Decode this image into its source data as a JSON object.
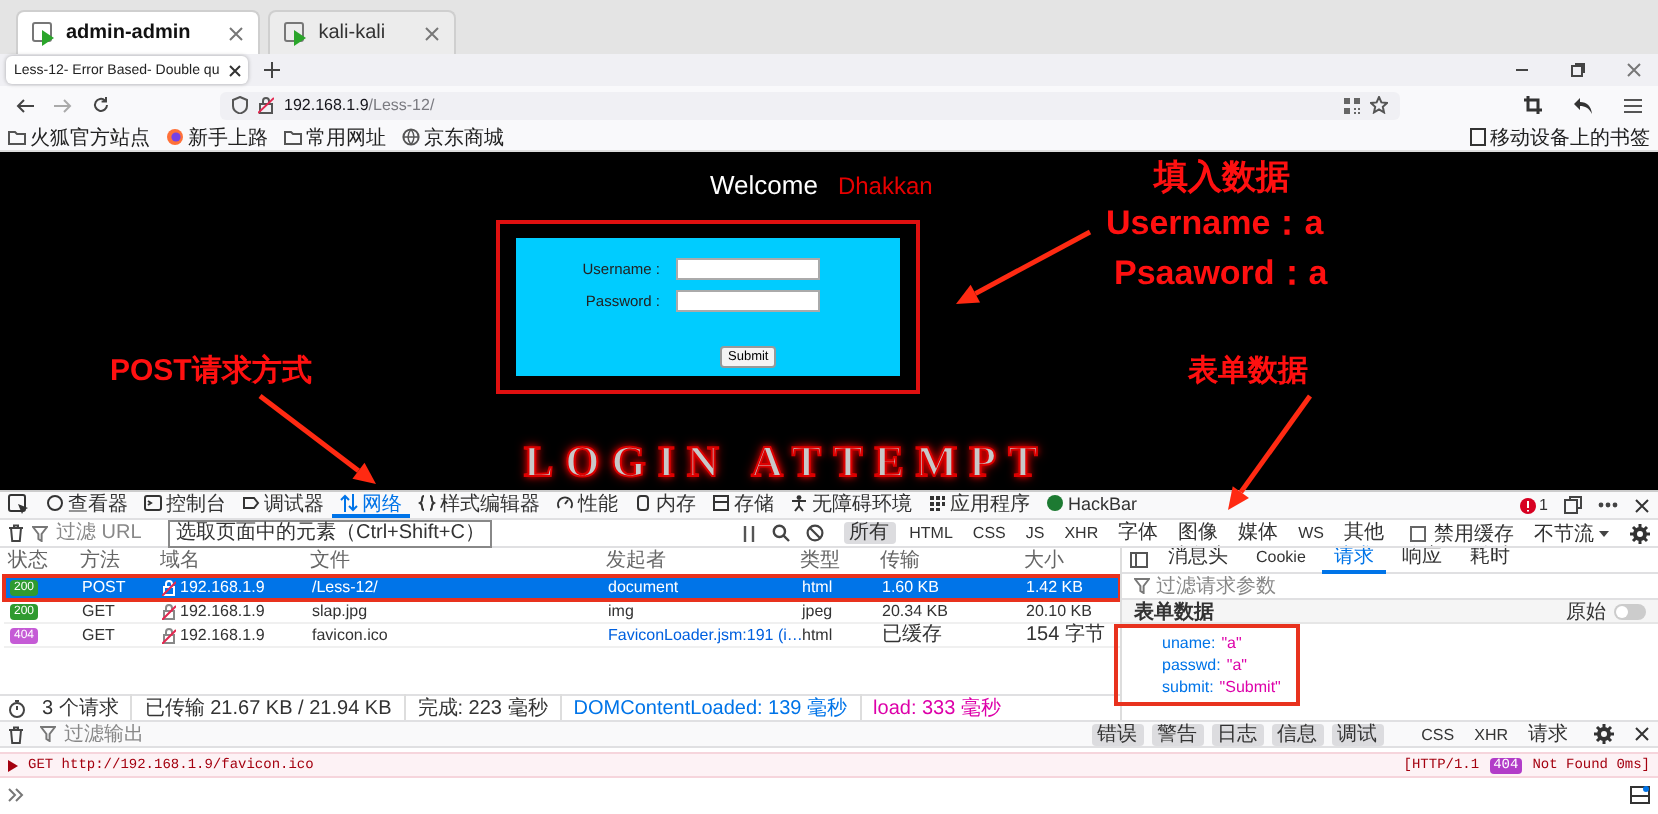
{
  "vm_tabs": [
    {
      "label": "admin-admin",
      "selected": true
    },
    {
      "label": "kali-kali",
      "selected": false
    }
  ],
  "browser_tab": {
    "title": "Less-12- Error Based- Double qu"
  },
  "address": {
    "host": "192.168.1.9",
    "path": "/Less-12/"
  },
  "bookmarks": [
    {
      "label": "火狐官方站点",
      "kind": "folder"
    },
    {
      "label": "新手上路",
      "kind": "firefox"
    },
    {
      "label": "常用网址",
      "kind": "folder"
    },
    {
      "label": "京东商城",
      "kind": "globe"
    }
  ],
  "mobile_bookmarks": {
    "label": "移动设备上的书签"
  },
  "page": {
    "welcome": "Welcome",
    "user": "Dhakkan",
    "form": {
      "highlighted": true,
      "fields": [
        {
          "label": "Username :"
        },
        {
          "label": "Password :"
        }
      ],
      "submit": "Submit"
    },
    "banner": "LOGIN ATTEMPT"
  },
  "annotations": [
    {
      "text": "填入数据"
    },
    {
      "text": "Username：a"
    },
    {
      "text": "Psaaword：a"
    },
    {
      "text": "POST请求方式"
    },
    {
      "text": "表单数据"
    }
  ],
  "devtools": {
    "tabs": [
      {
        "label": "查看器",
        "selected": false
      },
      {
        "label": "控制台",
        "selected": false
      },
      {
        "label": "调试器",
        "selected": false
      },
      {
        "label": "网络",
        "selected": true
      },
      {
        "label": "样式编辑器",
        "selected": false
      },
      {
        "label": "性能",
        "selected": false
      },
      {
        "label": "内存",
        "selected": false
      },
      {
        "label": "存储",
        "selected": false
      },
      {
        "label": "无障碍环境",
        "selected": false
      },
      {
        "label": "应用程序",
        "selected": false
      },
      {
        "label": "HackBar",
        "selected": false
      }
    ],
    "error_count": "1",
    "pick_tooltip": "选取页面中的元素（Ctrl+Shift+C）",
    "url_filter": {
      "placeholder": "过滤 URL"
    },
    "type_filters": [
      {
        "label": "所有",
        "selected": true
      },
      {
        "label": "HTML",
        "selected": false
      },
      {
        "label": "CSS",
        "selected": false
      },
      {
        "label": "JS",
        "selected": false
      },
      {
        "label": "XHR",
        "selected": false
      },
      {
        "label": "字体",
        "selected": false
      },
      {
        "label": "图像",
        "selected": false
      },
      {
        "label": "媒体",
        "selected": false
      },
      {
        "label": "WS",
        "selected": false
      },
      {
        "label": "其他",
        "selected": false
      }
    ],
    "disable_cache": {
      "label": "禁用缓存",
      "checked": false
    },
    "throttling": "不节流",
    "columns": [
      "状态",
      "方法",
      "域名",
      "文件",
      "发起者",
      "类型",
      "传输",
      "大小"
    ],
    "requests": [
      {
        "status": "200",
        "color": "#2f9a2f",
        "method": "POST",
        "domain": "192.168.1.9",
        "file": "/Less-12/",
        "initiator": "document",
        "initiator_link": false,
        "type": "html",
        "transferred": "1.60 KB",
        "size": "1.42 KB",
        "selected": true,
        "highlighted": true
      },
      {
        "status": "200",
        "color": "#2f9a2f",
        "method": "GET",
        "domain": "192.168.1.9",
        "file": "slap.jpg",
        "initiator": "img",
        "initiator_link": false,
        "type": "jpeg",
        "transferred": "20.34 KB",
        "size": "20.10 KB",
        "selected": false,
        "highlighted": false
      },
      {
        "status": "404",
        "color": "#c55bd6",
        "method": "GET",
        "domain": "192.168.1.9",
        "file": "favicon.ico",
        "initiator": "FaviconLoader.jsm:191 (i…",
        "initiator_link": true,
        "type": "html",
        "transferred": "已缓存",
        "size": "154 字节",
        "selected": false,
        "highlighted": false
      }
    ],
    "side_tabs": [
      {
        "label": "消息头",
        "selected": false
      },
      {
        "label": "Cookie",
        "selected": false
      },
      {
        "label": "请求",
        "selected": true
      },
      {
        "label": "响应",
        "selected": false
      },
      {
        "label": "耗时",
        "selected": false
      }
    ],
    "param_filter": {
      "placeholder": "过滤请求参数"
    },
    "form_data": {
      "title": "表单数据",
      "raw_label": "原始",
      "raw_on": false,
      "highlighted": true,
      "params": [
        {
          "name": "uname:",
          "value": "\"a\""
        },
        {
          "name": "passwd:",
          "value": "\"a\""
        },
        {
          "name": "submit:",
          "value": "\"Submit\""
        }
      ]
    },
    "status_bar": {
      "requests": "3 个请求",
      "transferred": "已传输 21.67 KB / 21.94 KB",
      "finished": "完成: 223 毫秒",
      "dom_content_loaded": "DOMContentLoaded: 139 毫秒",
      "load": "load: 333 毫秒"
    },
    "console": {
      "filter": {
        "placeholder": "过滤输出"
      },
      "levels": [
        {
          "label": "错误",
          "selected": true
        },
        {
          "label": "警告",
          "selected": true
        },
        {
          "label": "日志",
          "selected": true
        },
        {
          "label": "信息",
          "selected": true
        },
        {
          "label": "调试",
          "selected": true
        }
      ],
      "types": [
        {
          "label": "CSS",
          "selected": false
        },
        {
          "label": "XHR",
          "selected": false
        },
        {
          "label": "请求",
          "selected": false
        }
      ],
      "messages": [
        {
          "kind": "error",
          "text": "GET http://192.168.1.9/favicon.ico",
          "protocol": "[HTTP/1.1",
          "code": "404",
          "status": "Not Found 0ms]"
        }
      ]
    }
  }
}
